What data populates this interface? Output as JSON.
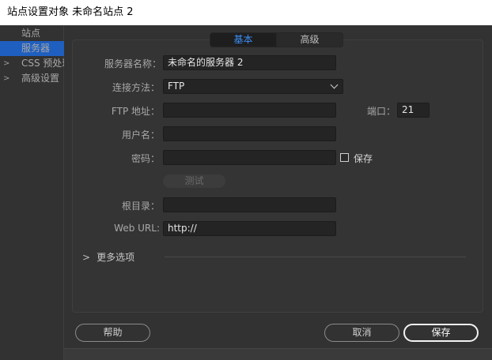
{
  "window": {
    "title": "站点设置对象 未命名站点 2"
  },
  "nav": {
    "items": [
      {
        "label": "站点",
        "chevron": false,
        "selected": false
      },
      {
        "label": "服务器",
        "chevron": false,
        "selected": true
      },
      {
        "label": "CSS 预处理器",
        "chevron": true,
        "selected": false
      },
      {
        "label": "高级设置",
        "chevron": true,
        "selected": false
      }
    ]
  },
  "tabs": {
    "basic": "基本",
    "advanced": "高级",
    "active": "basic"
  },
  "form": {
    "server_name": {
      "label": "服务器名称：",
      "value": "未命名的服务器 2"
    },
    "connect_method": {
      "label": "连接方法：",
      "value": "FTP"
    },
    "ftp_address": {
      "label": "FTP 地址：",
      "value": ""
    },
    "port": {
      "label": "端口：",
      "value": "21"
    },
    "username": {
      "label": "用户名：",
      "value": ""
    },
    "password": {
      "label": "密码：",
      "value": ""
    },
    "save_password": {
      "label": "保存",
      "checked": false
    },
    "test_button": "测试",
    "root_dir": {
      "label": "根目录：",
      "value": ""
    },
    "web_url": {
      "label": "Web URL:",
      "value": "http://"
    },
    "more_options": "更多选项"
  },
  "buttons": {
    "help": "帮助",
    "cancel": "取消",
    "save": "保存"
  },
  "colors": {
    "accent": "#3b8ff7",
    "selection": "#1f5fbf"
  }
}
